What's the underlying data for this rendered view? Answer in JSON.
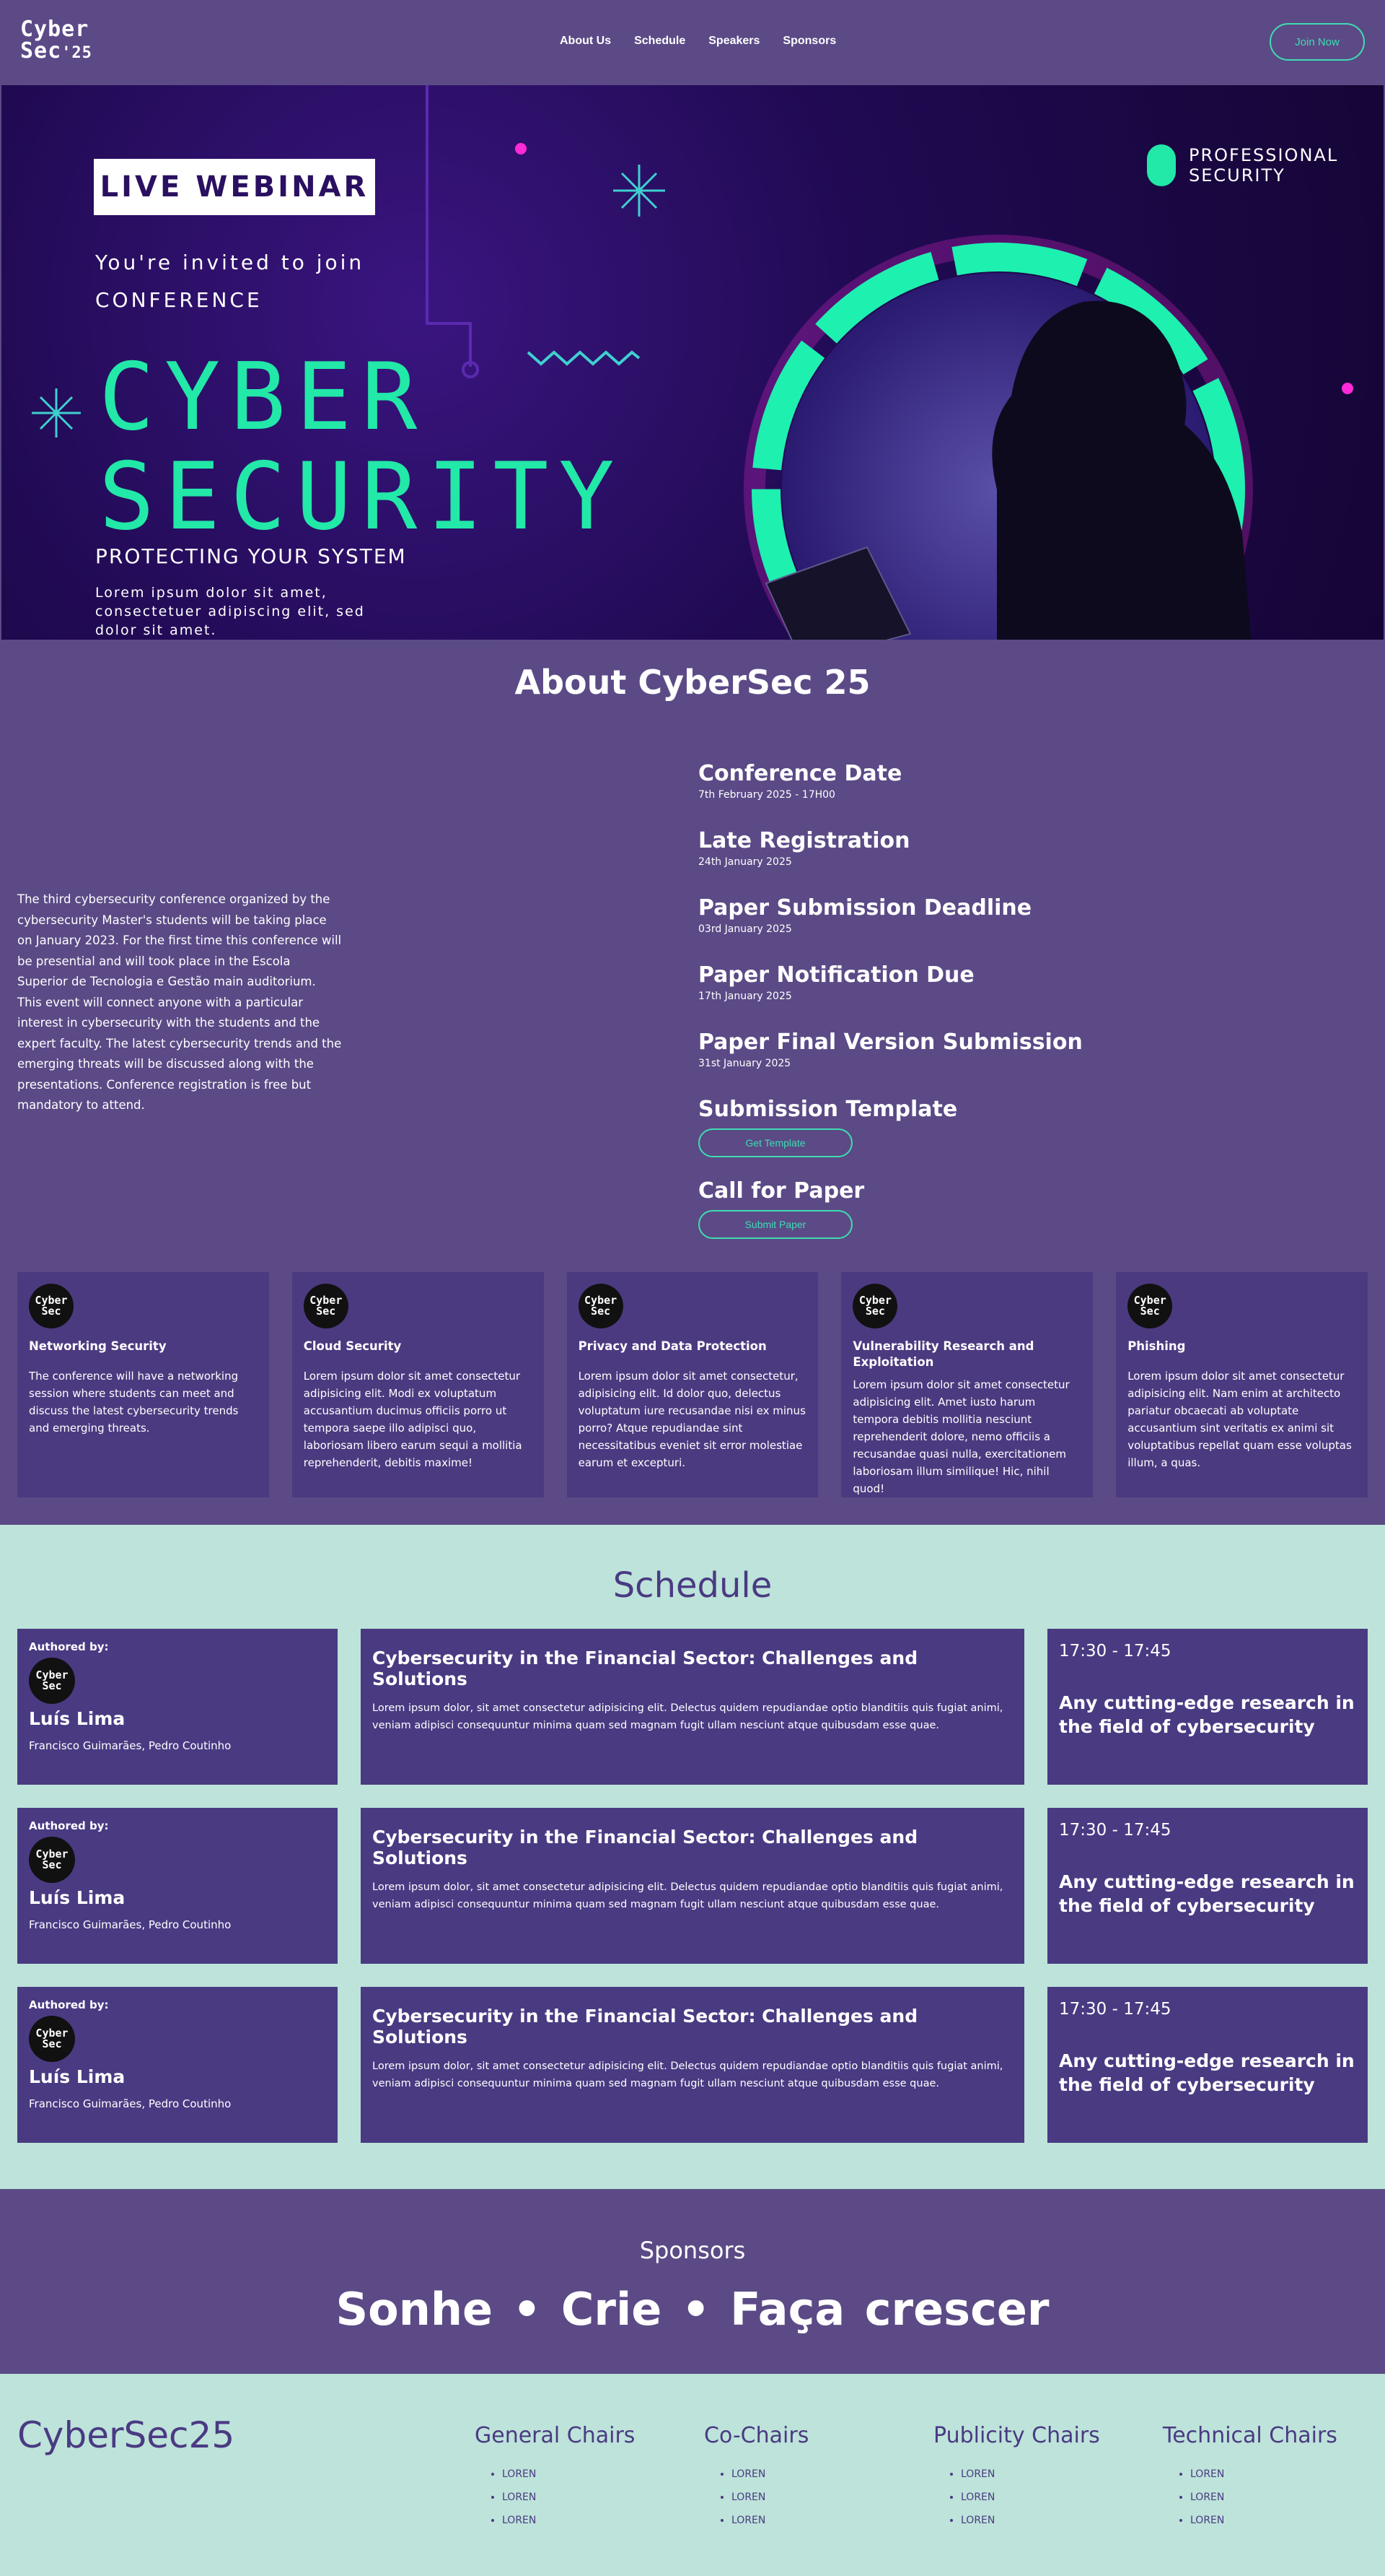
{
  "nav": {
    "logo_line1": "Cyber",
    "logo_line2": "Sec",
    "logo_suffix": "'25",
    "links": [
      "About Us",
      "Schedule",
      "Speakers",
      "Sponsors"
    ],
    "join_label": "Join Now"
  },
  "hero": {
    "badge": "LIVE WEBINAR",
    "invite_line1": "You're invited to join",
    "invite_line2": "CONFERENCE",
    "title_line1": "CYBER",
    "title_line2": "SECURITY",
    "subtitle": "PROTECTING YOUR SYSTEM",
    "lorem": "Lorem ipsum dolor sit amet, consectetuer adipiscing elit, sed dolor sit amet.",
    "corner_line1": "PROFESSIONAL",
    "corner_line2": "SECURITY"
  },
  "about": {
    "title": "About CyberSec 25",
    "description": "The third cybersecurity conference organized by the cybersecurity Master's students will be taking place on January 2023. For the first time this conference will be presential and will took place in the Escola Superior de Tecnologia e Gestão main auditorium. This event will connect anyone with a particular interest in cybersecurity with the students and the expert faculty. The latest cybersecurity trends and the emerging threats will be discussed along with the presentations. Conference registration is free but mandatory to attend.",
    "dates": [
      {
        "title": "Conference Date",
        "value": "7th February 2025 - 17H00"
      },
      {
        "title": "Late Registration",
        "value": "24th January 2025"
      },
      {
        "title": "Paper Submission Deadline",
        "value": "03rd January 2025"
      },
      {
        "title": "Paper Notification Due",
        "value": "17th January 2025"
      },
      {
        "title": "Paper Final Version Submission",
        "value": "31st January 2025"
      }
    ],
    "template_title": "Submission Template",
    "template_button": "Get Template",
    "cfp_title": "Call for Paper",
    "cfp_button": "Submit Paper",
    "topics": [
      {
        "title": "Networking Security",
        "text": "The conference will have a networking session where students can meet and discuss the latest cybersecurity trends and emerging threats."
      },
      {
        "title": "Cloud Security",
        "text": "Lorem ipsum dolor sit amet consectetur adipisicing elit. Modi ex voluptatum accusantium ducimus officiis porro ut tempora saepe illo adipisci quo, laboriosam libero earum sequi a mollitia reprehenderit, debitis maxime!"
      },
      {
        "title": "Privacy and Data Protection",
        "text": "Lorem ipsum dolor sit amet consectetur, adipisicing elit. Id dolor quo, delectus voluptatum iure recusandae nisi ex minus porro? Atque repudiandae sint necessitatibus eveniet sit error molestiae earum et excepturi."
      },
      {
        "title": "Vulnerability Research and Exploitation",
        "text": "Lorem ipsum dolor sit amet consectetur adipisicing elit. Amet iusto harum tempora debitis mollitia nesciunt reprehenderit dolore, nemo officiis a recusandae quasi nulla, exercitationem laboriosam illum similique! Hic, nihil quod!"
      },
      {
        "title": "Phishing",
        "text": "Lorem ipsum dolor sit amet consectetur adipisicing elit. Nam enim at architecto pariatur obcaecati ab voluptate accusantium sint veritatis ex animi sit voluptatibus repellat quam esse voluptas illum, a quas."
      }
    ]
  },
  "schedule": {
    "title": "Schedule",
    "rows": [
      {
        "authored_label": "Authored by:",
        "speaker": "Luís Lima",
        "coauthors": "Francisco Guimarães, Pedro Coutinho",
        "talk_title": "Cybersecurity in the Financial Sector: Challenges and Solutions",
        "talk_text": "Lorem ipsum dolor, sit amet consectetur adipisicing elit. Delectus quidem repudiandae optio blanditiis quis fugiat animi, veniam adipisci consequuntur minima quam sed magnam fugit ullam nesciunt atque quibusdam esse quae.",
        "time": "17:30 - 17:45",
        "topic": "Any cutting-edge research in the field of cybersecurity"
      },
      {
        "authored_label": "Authored by:",
        "speaker": "Luís Lima",
        "coauthors": "Francisco Guimarães, Pedro Coutinho",
        "talk_title": "Cybersecurity in the Financial Sector: Challenges and Solutions",
        "talk_text": "Lorem ipsum dolor, sit amet consectetur adipisicing elit. Delectus quidem repudiandae optio blanditiis quis fugiat animi, veniam adipisci consequuntur minima quam sed magnam fugit ullam nesciunt atque quibusdam esse quae.",
        "time": "17:30 - 17:45",
        "topic": "Any cutting-edge research in the field of cybersecurity"
      },
      {
        "authored_label": "Authored by:",
        "speaker": "Luís Lima",
        "coauthors": "Francisco Guimarães, Pedro Coutinho",
        "talk_title": "Cybersecurity in the Financial Sector: Challenges and Solutions",
        "talk_text": "Lorem ipsum dolor, sit amet consectetur adipisicing elit. Delectus quidem repudiandae optio blanditiis quis fugiat animi, veniam adipisci consequuntur minima quam sed magnam fugit ullam nesciunt atque quibusdam esse quae.",
        "time": "17:30 - 17:45",
        "topic": "Any cutting-edge research in the field of cybersecurity"
      }
    ]
  },
  "sponsors": {
    "title": "Sponsors",
    "slogan": "Sonhe  •  Crie  •  Faça crescer"
  },
  "footer": {
    "brand": "CyberSec25",
    "columns": [
      {
        "title": "General Chairs",
        "items": [
          "LOREN",
          "LOREN",
          "LOREN"
        ]
      },
      {
        "title": "Co-Chairs",
        "items": [
          "LOREN",
          "LOREN",
          "LOREN"
        ]
      },
      {
        "title": "Publicity Chairs",
        "items": [
          "LOREN",
          "LOREN",
          "LOREN"
        ]
      },
      {
        "title": "Technical Chairs",
        "items": [
          "LOREN",
          "LOREN",
          "LOREN"
        ]
      }
    ]
  },
  "colors": {
    "page_purple": "#5b4a86",
    "card_purple": "#4a3a82",
    "accent_green": "#3fdcb2",
    "mint_bg": "#bde3da",
    "hero_title_green": "#22e8a8"
  }
}
